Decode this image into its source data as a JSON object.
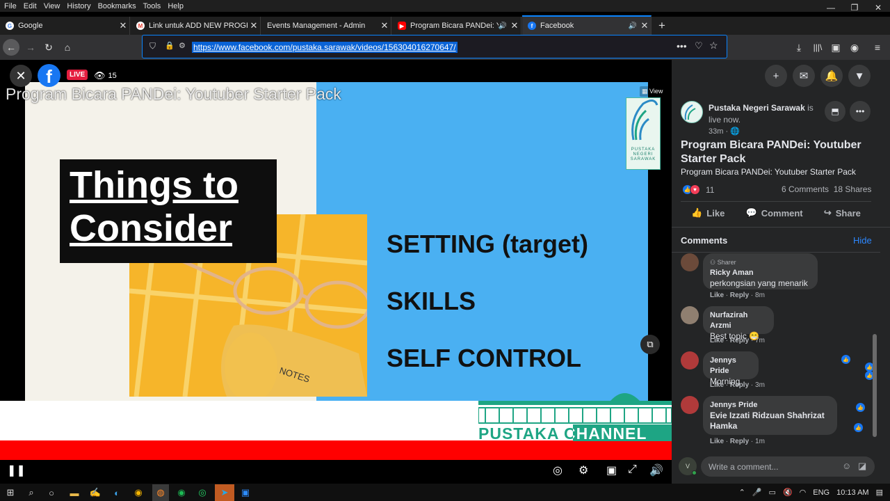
{
  "menubar": {
    "items": [
      "File",
      "Edit",
      "View",
      "History",
      "Bookmarks",
      "Tools",
      "Help"
    ]
  },
  "window_controls": {
    "minimize": "—",
    "restore": "❐",
    "close": "✕"
  },
  "tabs": [
    {
      "title": "Google",
      "favicon": "google-icon",
      "color": "#4285f4",
      "glyph": "G"
    },
    {
      "title": "Link untuk ADD NEW PROGRAM",
      "favicon": "gmail-icon",
      "color": "#ea4335",
      "glyph": "M"
    },
    {
      "title": "Events Management - Admin",
      "favicon": "",
      "color": "",
      "glyph": ""
    },
    {
      "title": "Program Bicara PANDei: Yo",
      "favicon": "youtube-icon",
      "color": "#ff0000",
      "glyph": "▶"
    },
    {
      "title": "Facebook",
      "favicon": "facebook-icon",
      "color": "#1877f2",
      "glyph": "f"
    }
  ],
  "nav": {
    "url": "https://www.facebook.com/pustaka.sarawak/videos/156304016270647/"
  },
  "video": {
    "title_overlay": "Program Bicara PANDei: Youtuber Starter Pack",
    "live_label": "LIVE",
    "viewer_count": "15",
    "view_tag": "View",
    "slide": {
      "heading_line1": "Things to",
      "heading_line2": "Consider",
      "items": [
        "SETTING (target)",
        "SKILLS",
        "SELF CONTROL"
      ],
      "notes_label": "NOTES",
      "logo_text": "PUSTAKA NEGERI SARAWAK",
      "channel_text": "PUSTAKA CHANNEL"
    }
  },
  "post": {
    "page_name": "Pustaka Negeri Sarawak",
    "status": "is live now.",
    "time": "33m · 🌐",
    "title": "Program Bicara PANDei: Youtuber Starter Pack",
    "subtitle": "Program Bicara PANDei: Youtuber Starter Pack",
    "reaction_count": "11",
    "comments_count": "6 Comments",
    "shares_count": "18 Shares",
    "actions": {
      "like": "Like",
      "comment": "Comment",
      "share": "Share"
    }
  },
  "comments_section": {
    "header": "Comments",
    "hide_label": "Hide",
    "like_label": "Like",
    "reply_label": "Reply",
    "items": [
      {
        "sharer_label": "Sharer",
        "name": "Ricky Aman",
        "text": "perkongsian yang menarik",
        "time": "8m"
      },
      {
        "name": "Nurfazirah Arzmi",
        "text": "Best topic 😁",
        "time": "7m"
      },
      {
        "name": "Jennys Pride",
        "text": "Morning",
        "time": "3m"
      },
      {
        "name": "Jennys Pride",
        "text": "Evie Izzati Ridzuan Shahrizat Hamka",
        "time": "1m"
      }
    ],
    "write_placeholder": "Write a comment..."
  },
  "taskbar": {
    "lang": "ENG",
    "time": "10:13 AM"
  },
  "colors": {
    "fb_blue": "#1877f2",
    "panel_bg": "#242526",
    "slide_blue": "#4ab0f2",
    "slide_yellow": "#f6b52a",
    "live_red": "#e41e3f",
    "channel_green": "#1ea584"
  }
}
